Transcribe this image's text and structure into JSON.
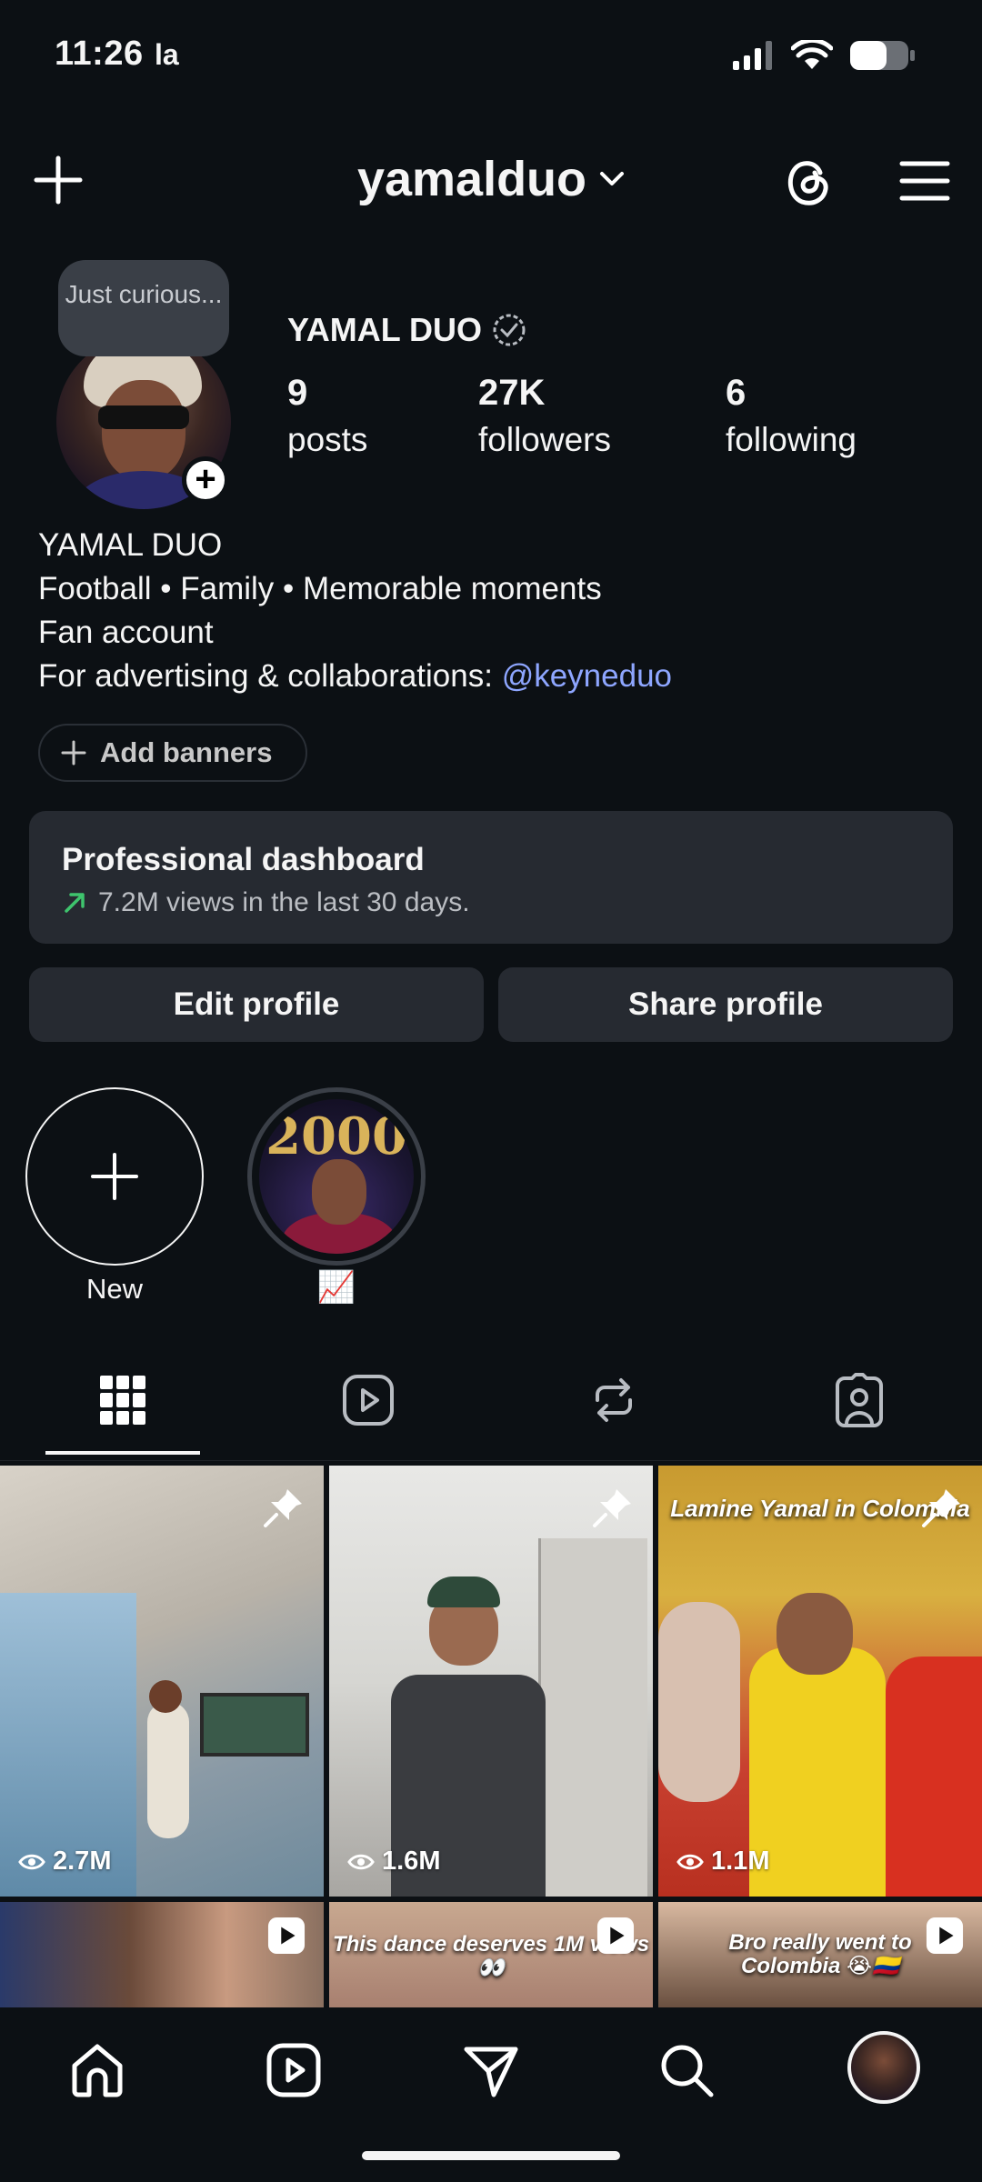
{
  "status_bar": {
    "time": "11:26",
    "carrier": "la"
  },
  "header": {
    "username": "yamalduo"
  },
  "profile": {
    "note": "Just curious...",
    "display_name": "YAMAL DUO",
    "stats": [
      {
        "value": "9",
        "label": "posts"
      },
      {
        "value": "27K",
        "label": "followers"
      },
      {
        "value": "6",
        "label": "following"
      }
    ],
    "bio": {
      "line1": "YAMAL DUO",
      "line2": "Football • Family • Memorable moments",
      "line3": "Fan account",
      "line4_prefix": "For advertising & collaborations: ",
      "line4_mention": "@keyneduo"
    },
    "add_banners_label": "Add banners"
  },
  "dashboard": {
    "title": "Professional dashboard",
    "subtitle": "7.2M views in the last 30 days."
  },
  "actions": {
    "edit_label": "Edit profile",
    "share_label": "Share profile"
  },
  "highlights": [
    {
      "label": "New"
    },
    {
      "label": "📈",
      "cover_text": "2000"
    }
  ],
  "posts": [
    {
      "views": "2.7M",
      "pinned": true,
      "caption": ""
    },
    {
      "views": "1.6M",
      "pinned": true,
      "caption": ""
    },
    {
      "views": "1.1M",
      "pinned": true,
      "caption": "Lamine Yamal in Colombia"
    },
    {
      "views": "",
      "pinned": false,
      "caption": ""
    },
    {
      "views": "",
      "pinned": false,
      "caption": "This dance deserves 1M views 👀"
    },
    {
      "views": "",
      "pinned": false,
      "caption": "Bro really went to Colombia 😭🇨🇴"
    }
  ],
  "colors": {
    "background": "#0c1014",
    "card": "#262a31",
    "mention": "#8ea6ff",
    "trend_arrow": "#3ec46d"
  }
}
